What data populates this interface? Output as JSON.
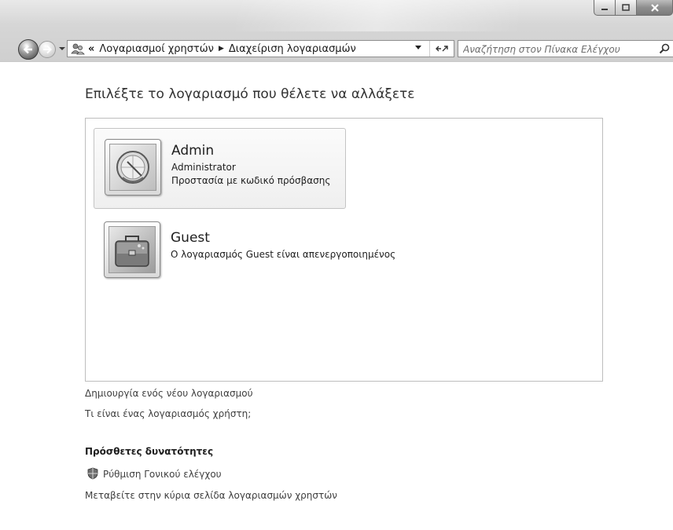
{
  "window": {
    "buttons": {
      "minimize": "minimize-icon",
      "maximize": "maximize-icon",
      "close": "close-icon"
    }
  },
  "toolbar": {
    "back_icon": "back-arrow-icon",
    "forward_icon": "forward-arrow-icon",
    "address": {
      "icon": "user-accounts-icon",
      "overflow": "«",
      "crumbs": [
        "Λογαριασμοί χρηστών",
        "Διαχείριση λογαριασμών"
      ],
      "separator_icon": "breadcrumb-arrow-icon",
      "refresh_label": "⁴↗"
    },
    "search": {
      "placeholder": "Αναζήτηση στον Πίνακα Ελέγχου",
      "value": ""
    }
  },
  "main": {
    "title": "Επιλέξτε το λογαριασμό που θέλετε να αλλάξετε",
    "accounts": [
      {
        "name": "Admin",
        "lines": [
          "Administrator",
          "Προστασία με κωδικό πρόσβασης"
        ],
        "picture": "account-picture-icon",
        "selected": true
      },
      {
        "name": "Guest",
        "lines": [
          "Ο λογαριασμός Guest είναι απενεργοποιημένος"
        ],
        "picture": "guest-briefcase-icon",
        "selected": false
      }
    ],
    "links": {
      "create": "Δημιουργία ενός νέου λογαριασμού",
      "what_is": "Τι είναι ένας λογαριασμός χρήστη;"
    },
    "additional": {
      "heading": "Πρόσθετες δυνατότητες",
      "parental": "Ρύθμιση Γονικού ελέγχου",
      "main_page": "Μεταβείτε στην κύρια σελίδα λογαριασμών χρηστών"
    }
  }
}
